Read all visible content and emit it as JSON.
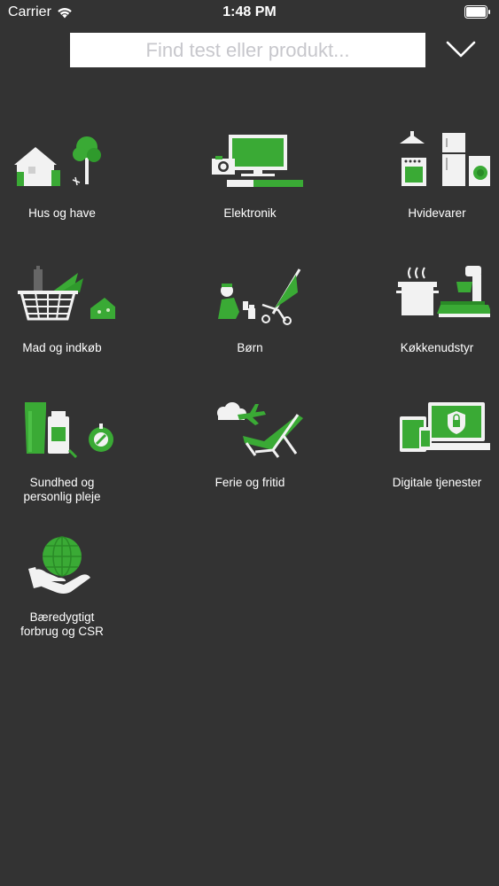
{
  "status_bar": {
    "carrier": "Carrier",
    "time": "1:48 PM"
  },
  "search": {
    "placeholder": "Find test eller produkt..."
  },
  "colors": {
    "background": "#333333",
    "accent": "#3aaa35",
    "icon_light": "#f2f2f2"
  },
  "categories": [
    {
      "label": "Hus og have",
      "icon": "house-tree-icon"
    },
    {
      "label": "Elektronik",
      "icon": "tv-camera-icon"
    },
    {
      "label": "Hvidevarer",
      "icon": "appliances-icon"
    },
    {
      "label": "Mad og indkøb",
      "icon": "shopping-basket-icon"
    },
    {
      "label": "Børn",
      "icon": "child-stroller-icon"
    },
    {
      "label": "Køkkenudstyr",
      "icon": "kitchen-pot-mixer-icon"
    },
    {
      "label": "Sundhed og\npersonlig pleje",
      "icon": "health-care-icon"
    },
    {
      "label": "Ferie og fritid",
      "icon": "plane-beach-chair-icon"
    },
    {
      "label": "Digitale tjenester",
      "icon": "devices-security-icon"
    },
    {
      "label": "Bæredygtigt\nforbrug og CSR",
      "icon": "globe-hand-icon"
    }
  ]
}
